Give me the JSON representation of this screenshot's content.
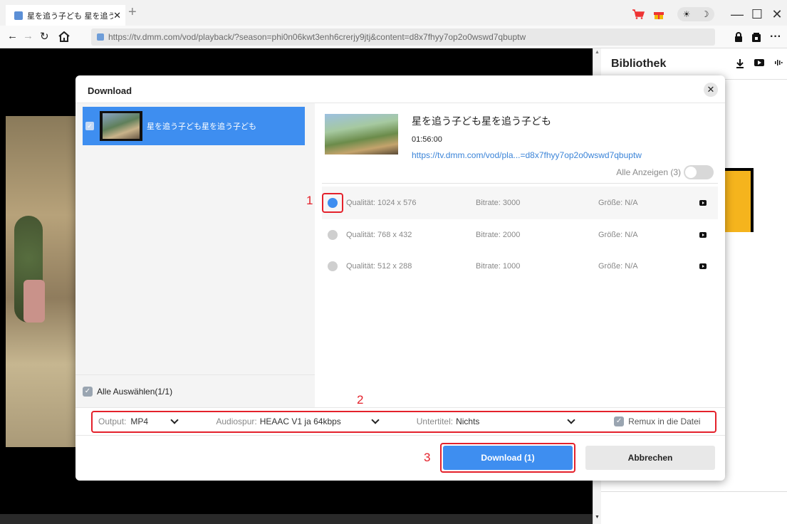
{
  "browser": {
    "tab_title": "星を追う子ども 星を追う",
    "tab_close": "✕",
    "new_tab": "+",
    "url": "https://tv.dmm.com/vod/playback/?season=phi0n06kwt3enh6crerjy9jtj&content=d8x7fhyy7op2o0wswd7qbuptw",
    "minimize": "—",
    "maximize": "☐",
    "close": "✕",
    "more": "···",
    "theme_sun": "☀",
    "theme_moon": "☽"
  },
  "library": {
    "title": "Bibliothek"
  },
  "dialog": {
    "title": "Download",
    "close": "✕",
    "list_item_name": "星を追う子ども星を追う子ども",
    "select_all": "Alle Auswählen(1/1)",
    "video_title": "星を追う子ども星を追う子ども",
    "duration": "01:56:00",
    "link": "https://tv.dmm.com/vod/pla...=d8x7fhyy7op2o0wswd7qbuptw",
    "show_all": "Alle Anzeigen (3)",
    "qualities": [
      {
        "quality": "Qualität: 1024 x 576",
        "bitrate": "Bitrate: 3000",
        "size": "Größe: N/A",
        "selected": true
      },
      {
        "quality": "Qualität: 768 x 432",
        "bitrate": "Bitrate: 2000",
        "size": "Größe: N/A",
        "selected": false
      },
      {
        "quality": "Qualität: 512 x 288",
        "bitrate": "Bitrate: 1000",
        "size": "Größe: N/A",
        "selected": false
      }
    ],
    "output_label": "Output:",
    "output_value": "MP4",
    "audio_label": "Audiospur:",
    "audio_value": "HEAAC V1 ja 64kbps",
    "subtitle_label": "Untertitel:",
    "subtitle_value": "Nichts",
    "remux_label": "Remux in die Datei",
    "download_button": "Download (1)",
    "cancel_button": "Abbrechen"
  },
  "annotations": {
    "one": "1",
    "two": "2",
    "three": "3"
  },
  "colors": {
    "accent": "#3e8ef0",
    "annotation": "#e4212b"
  }
}
